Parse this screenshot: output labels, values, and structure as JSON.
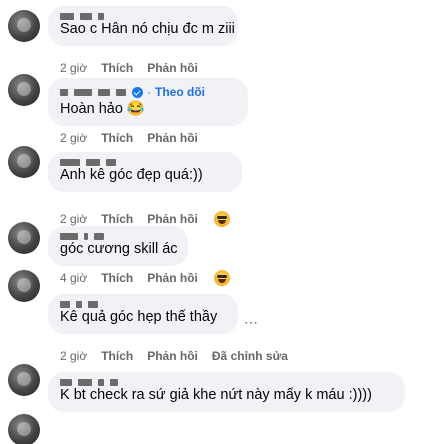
{
  "comments": [
    {
      "author": "",
      "text": "Sao c Hân nó chịu đc m ziii",
      "time": "2 giờ",
      "like": "Thích",
      "reply": "Phản hồi"
    },
    {
      "author": "",
      "follow_label": "Theo dõi",
      "text": "Hoàn hảo 😂",
      "time": "2 giờ",
      "like": "Thích",
      "reply": "Phản hồi"
    },
    {
      "author": "",
      "text": "Anh kê góc đẹp quá:))",
      "time": "2 giờ",
      "like": "Thích",
      "reply": "Phản hồi",
      "reaction": "haha-icon"
    },
    {
      "author": "",
      "text": "góc cương skill ác",
      "time": "4 giờ",
      "like": "Thích",
      "reply": "Phản hồi",
      "reaction": "haha-icon"
    },
    {
      "author": "",
      "text": "Kê quả góc hẹp thế thầy",
      "time": "2 giờ",
      "like": "Thích",
      "reply": "Phản hồi",
      "edited": "Đã chỉnh sửa"
    },
    {
      "author": "",
      "text": "K bt check ra sứ giả khe nứt này mấy k máu :))))"
    }
  ]
}
